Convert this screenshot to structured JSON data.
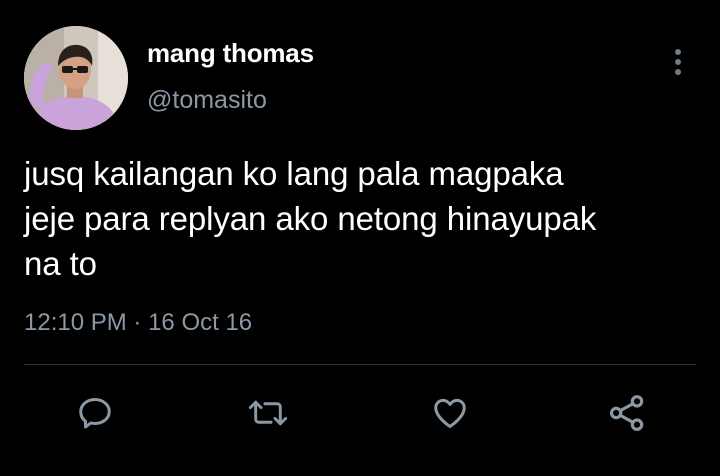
{
  "tweet": {
    "author": {
      "display_name": "mang thomas",
      "handle": "@tomasito",
      "avatar_icon": "profile-photo"
    },
    "text_lines": [
      "jusq kailangan ko lang pala magpaka",
      "jeje para replyan ako netong hinayupak",
      "na to"
    ],
    "time": "12:10 PM",
    "separator": "·",
    "date": "16 Oct 16",
    "actions": [
      {
        "name": "reply",
        "icon": "speech-bubble-icon"
      },
      {
        "name": "retweet",
        "icon": "retweet-icon"
      },
      {
        "name": "like",
        "icon": "heart-icon"
      },
      {
        "name": "share",
        "icon": "share-icon"
      }
    ],
    "more_icon": "vertical-ellipsis-icon"
  },
  "colors": {
    "background": "#000000",
    "text": "#ffffff",
    "muted": "#8b98a5",
    "divider": "#2f3336"
  }
}
